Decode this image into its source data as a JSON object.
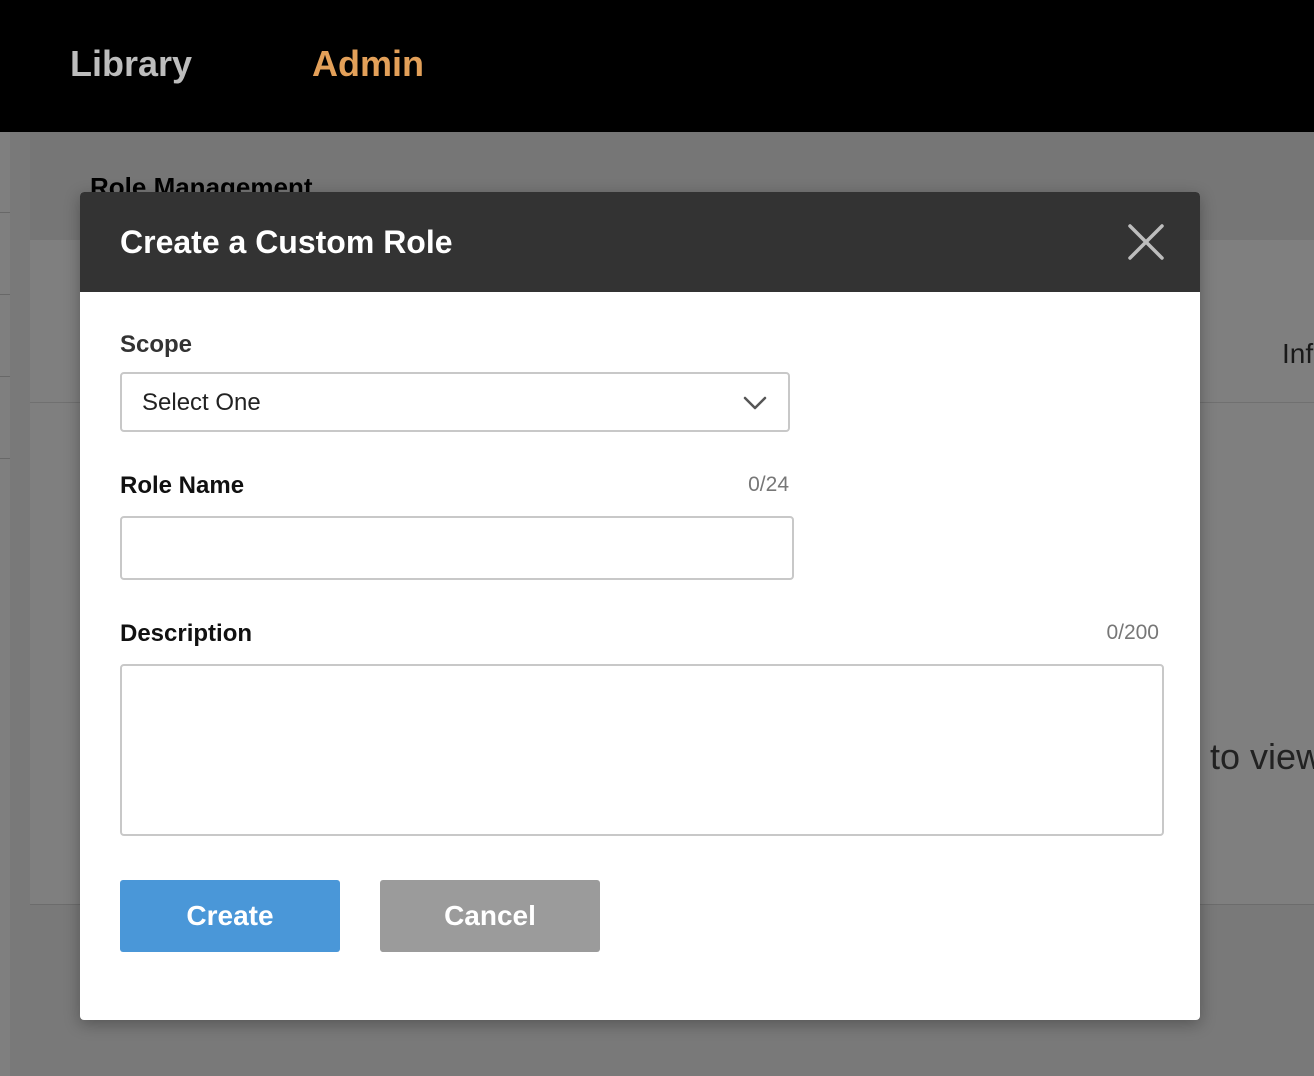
{
  "nav": {
    "items": [
      {
        "label": "Library",
        "active": false
      },
      {
        "label": "Admin",
        "active": true
      }
    ],
    "active_color": "#e3a059"
  },
  "background_page": {
    "title": "Role Management",
    "column_header": "Inf",
    "empty_text": "e to view"
  },
  "modal": {
    "title": "Create a Custom Role",
    "header_color": "#333333",
    "close_icon": "close-icon",
    "scope": {
      "label": "Scope",
      "value": "Select One",
      "icon": "chevron-down-icon"
    },
    "role_name": {
      "label": "Role Name",
      "counter": "0/24",
      "value": ""
    },
    "description": {
      "label": "Description",
      "counter": "0/200",
      "value": ""
    },
    "buttons": {
      "create_label": "Create",
      "create_color": "#4a97d8",
      "cancel_label": "Cancel",
      "cancel_color": "#9b9b9b"
    }
  }
}
